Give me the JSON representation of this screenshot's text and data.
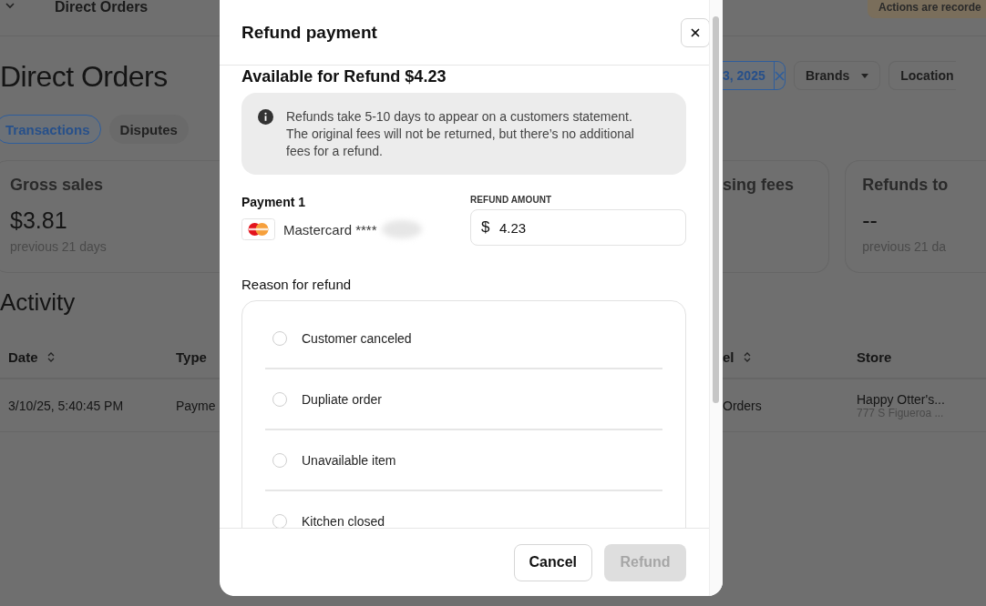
{
  "background_page": {
    "header_title": "Direct Orders",
    "notice_badge": "Actions are recorde",
    "page_title": "Direct Orders",
    "tabs": [
      {
        "label": "Transactions",
        "selected": true
      },
      {
        "label": "Disputes",
        "selected": false
      }
    ],
    "filters": [
      {
        "kind": "date_range",
        "label": "3, 2025"
      },
      {
        "kind": "dropdown",
        "label": "Brands"
      },
      {
        "kind": "button",
        "label": "Location"
      }
    ],
    "cards": [
      {
        "title": "Gross sales",
        "value": "$3.81",
        "caption": "previous 21 days"
      },
      {
        "title": "sing fees"
      },
      {
        "title": "Refunds to",
        "value": "--",
        "caption": "previous 21 da"
      }
    ],
    "section_title": "Activity",
    "table": {
      "columns": [
        {
          "label": "Date",
          "sortable": true
        },
        {
          "label": "Type",
          "sortable": false
        },
        {
          "label": "el",
          "sortable": true
        },
        {
          "label": "Store",
          "sortable": false
        }
      ],
      "rows": [
        {
          "cells": [
            {
              "text": "3/10/25, 5:40:45 PM"
            },
            {
              "text": "Payme"
            },
            {
              "text": "Orders"
            },
            {
              "text": "Happy Otter's...",
              "subtext": "777 S Figueroa ..."
            }
          ]
        }
      ]
    }
  },
  "modal": {
    "title": "Refund payment",
    "available": "Available for Refund $4.23",
    "info": "Refunds take 5-10 days to appear on a customers statement. The original fees will not be returned, but there’s no additional fees for a refund.",
    "payment_label": "Payment 1",
    "card_name": "Mastercard ****",
    "card_number_hidden": true,
    "amount_label": "REFUND AMOUNT",
    "currency": "$",
    "amount": "4.23",
    "reason_label": "Reason for refund",
    "reasons": [
      {
        "label": "Customer canceled",
        "selected": false
      },
      {
        "label": "Dupliate order",
        "selected": false
      },
      {
        "label": "Unavailable item",
        "selected": false
      },
      {
        "label": "Kitchen closed",
        "selected": false
      }
    ],
    "cancel": "Cancel",
    "refund": {
      "label": "Refund",
      "disabled": true
    }
  }
}
